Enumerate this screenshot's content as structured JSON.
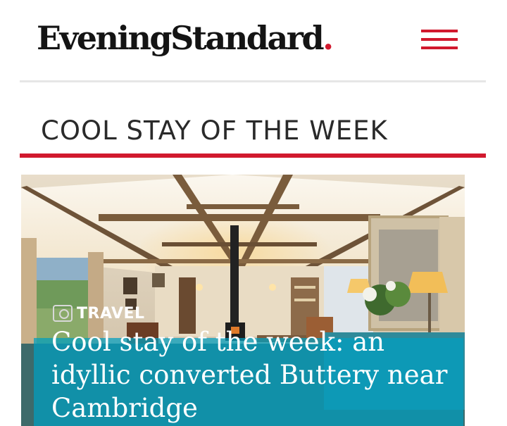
{
  "header": {
    "logo_text": "EveningStandard",
    "logo_dot": ".",
    "menu_icon": "hamburger-menu-icon"
  },
  "section": {
    "title": "COOL STAY OF THE WEEK"
  },
  "article": {
    "category": "TRAVEL",
    "category_icon": "gallery-icon",
    "headline": "Cool stay of the week: an idyllic converted Buttery near Cambridge"
  },
  "colors": {
    "brand_red": "#d1192e",
    "headline_overlay": "#00a0c0"
  }
}
